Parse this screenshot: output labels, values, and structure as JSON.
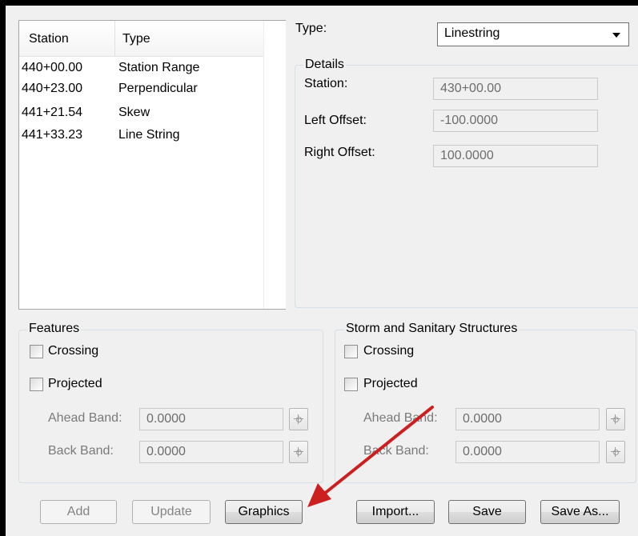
{
  "list": {
    "headers": {
      "station": "Station",
      "type": "Type"
    },
    "rows": [
      {
        "station": "440+00.00",
        "type": "Station Range"
      },
      {
        "station": "440+23.00",
        "type": "Perpendicular"
      },
      {
        "station": "441+21.54",
        "type": "Skew"
      },
      {
        "station": "441+33.23",
        "type": "Line String"
      }
    ]
  },
  "type_select": {
    "label": "Type:",
    "value": "Linestring"
  },
  "details": {
    "title": "Details",
    "station_label": "Station:",
    "station_value": "430+00.00",
    "left_offset_label": "Left Offset:",
    "left_offset_value": "-100.0000",
    "right_offset_label": "Right Offset:",
    "right_offset_value": "100.0000"
  },
  "features": {
    "title": "Features",
    "crossing_label": "Crossing",
    "projected_label": "Projected",
    "ahead_band_label": "Ahead Band:",
    "ahead_band_value": "0.0000",
    "back_band_label": "Back Band:",
    "back_band_value": "0.0000"
  },
  "structures": {
    "title": "Storm and Sanitary Structures",
    "crossing_label": "Crossing",
    "projected_label": "Projected",
    "ahead_band_label": "Ahead Band:",
    "ahead_band_value": "0.0000",
    "back_band_label": "Back Band:",
    "back_band_value": "0.0000"
  },
  "buttons": {
    "add": "Add",
    "update": "Update",
    "graphics": "Graphics",
    "import": "Import...",
    "save": "Save",
    "save_as": "Save As..."
  },
  "colors": {
    "annotation_arrow": "#cc1f1f"
  }
}
